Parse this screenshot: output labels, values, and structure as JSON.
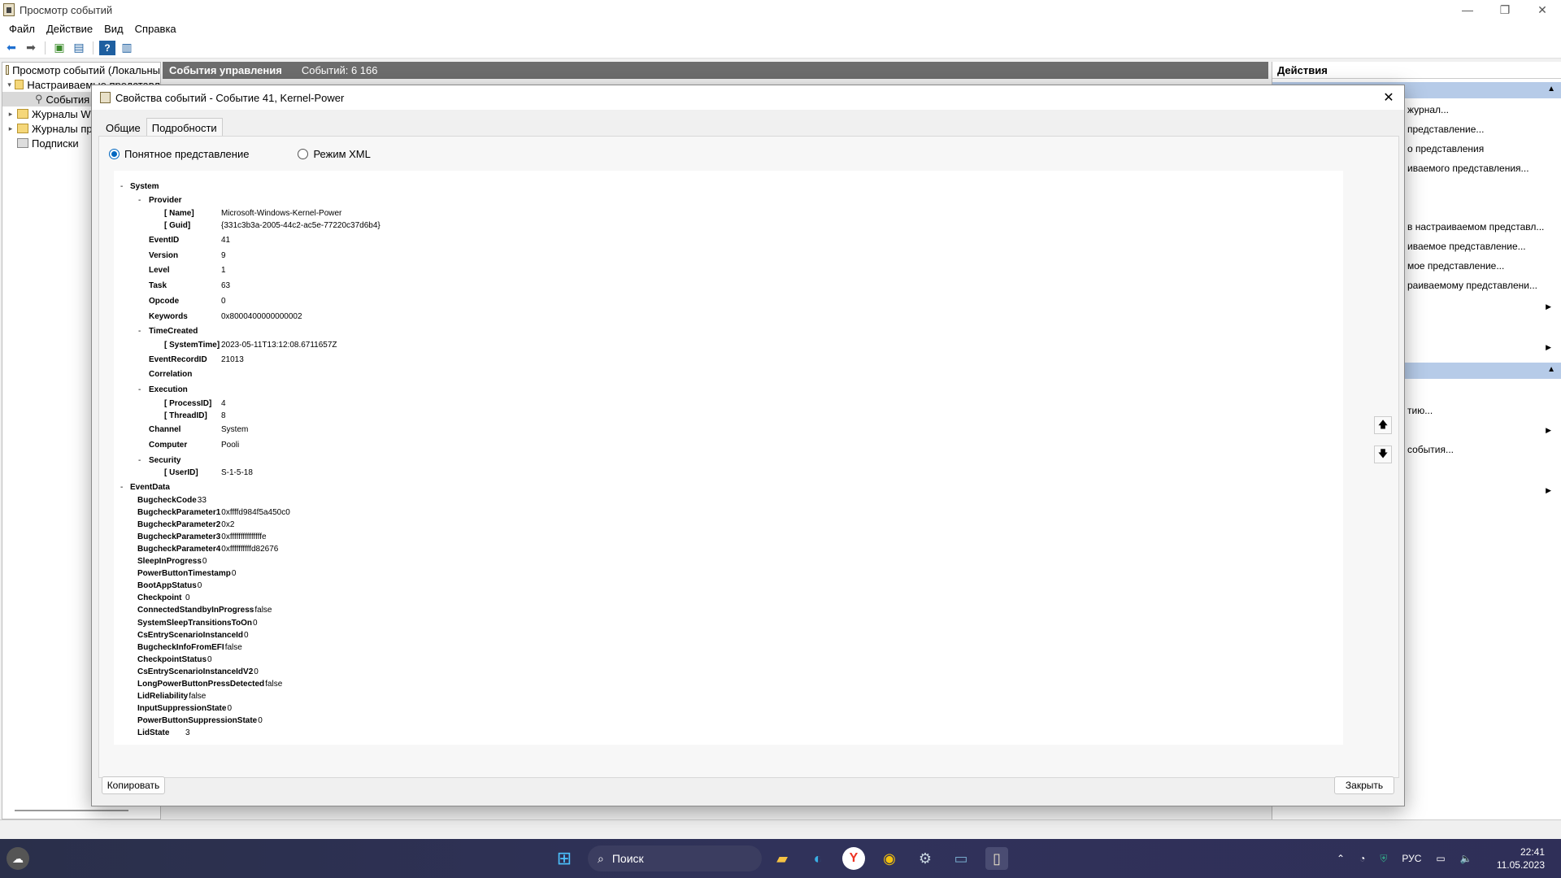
{
  "window": {
    "title": "Просмотр событий"
  },
  "menu": [
    "Файл",
    "Действие",
    "Вид",
    "Справка"
  ],
  "tree": {
    "items": [
      {
        "label": "Просмотр событий (Локальны",
        "indent": 0
      },
      {
        "label": "Настраиваемые представл",
        "indent": 1
      },
      {
        "label": "События",
        "indent": 2
      },
      {
        "label": "Журналы W",
        "indent": 1
      },
      {
        "label": "Журналы пр",
        "indent": 1
      },
      {
        "label": "Подписки",
        "indent": 1
      }
    ]
  },
  "center_header": {
    "title": "События управления",
    "count": "Событий: 6 166"
  },
  "actions": {
    "header": "Действия",
    "items": [
      "журнал...",
      "представление...",
      "о представления",
      "иваемого представления...",
      "в настраиваемом представл...",
      "иваемое представление...",
      "мое представление...",
      "раиваемому представлени...",
      "тию...",
      "события..."
    ]
  },
  "dialog": {
    "title": "Свойства событий - Событие 41, Kernel-Power",
    "tabs": [
      "Общие",
      "Подробности"
    ],
    "radio_friendly": "Понятное представление",
    "radio_xml": "Режим XML",
    "copy_button": "Копировать",
    "close_button": "Закрыть"
  },
  "xml": {
    "system": "System",
    "provider": "Provider",
    "name_k": "[ Name]",
    "name_v": "Microsoft-Windows-Kernel-Power",
    "guid_k": "[ Guid]",
    "guid_v": "{331c3b3a-2005-44c2-ac5e-77220c37d6b4}",
    "rows1": [
      {
        "k": "EventID",
        "v": "41"
      },
      {
        "k": "Version",
        "v": "9"
      },
      {
        "k": "Level",
        "v": "1"
      },
      {
        "k": "Task",
        "v": "63"
      },
      {
        "k": "Opcode",
        "v": "0"
      },
      {
        "k": "Keywords",
        "v": "0x8000400000000002"
      }
    ],
    "timecreated": "TimeCreated",
    "systemtime_k": "[ SystemTime]",
    "systemtime_v": "2023-05-11T13:12:08.6711657Z",
    "eventrecordid_k": "EventRecordID",
    "eventrecordid_v": "21013",
    "correlation": "Correlation",
    "execution": "Execution",
    "processid_k": "[ ProcessID]",
    "processid_v": "4",
    "threadid_k": "[ ThreadID]",
    "threadid_v": "8",
    "channel_k": "Channel",
    "channel_v": "System",
    "computer_k": "Computer",
    "computer_v": "Pooli",
    "security": "Security",
    "userid_k": "[ UserID]",
    "userid_v": "S-1-5-18",
    "eventdata": "EventData",
    "data": [
      {
        "k": "BugcheckCode",
        "v": "33"
      },
      {
        "k": "BugcheckParameter1",
        "v": "0xffffd984f5a450c0"
      },
      {
        "k": "BugcheckParameter2",
        "v": "0x2"
      },
      {
        "k": "BugcheckParameter3",
        "v": "0xfffffffffffffffe"
      },
      {
        "k": "BugcheckParameter4",
        "v": "0xffffffffffd82676"
      },
      {
        "k": "SleepInProgress",
        "v": "0"
      },
      {
        "k": "PowerButtonTimestamp",
        "v": "0"
      },
      {
        "k": "BootAppStatus",
        "v": "0"
      },
      {
        "k": "Checkpoint",
        "v": "0"
      },
      {
        "k": "ConnectedStandbyInProgress",
        "v": "false"
      },
      {
        "k": "SystemSleepTransitionsToOn",
        "v": "0"
      },
      {
        "k": "CsEntryScenarioInstanceId",
        "v": "0"
      },
      {
        "k": "BugcheckInfoFromEFI",
        "v": "false"
      },
      {
        "k": "CheckpointStatus",
        "v": "0"
      },
      {
        "k": "CsEntryScenarioInstanceIdV2",
        "v": "0"
      },
      {
        "k": "LongPowerButtonPressDetected",
        "v": "false"
      },
      {
        "k": "LidReliability",
        "v": "false"
      },
      {
        "k": "InputSuppressionState",
        "v": "0"
      },
      {
        "k": "PowerButtonSuppressionState",
        "v": "0"
      },
      {
        "k": "LidState",
        "v": "3"
      }
    ]
  },
  "taskbar": {
    "search": "Поиск",
    "lang": "РУС",
    "time": "22:41",
    "date": "11.05.2023"
  }
}
